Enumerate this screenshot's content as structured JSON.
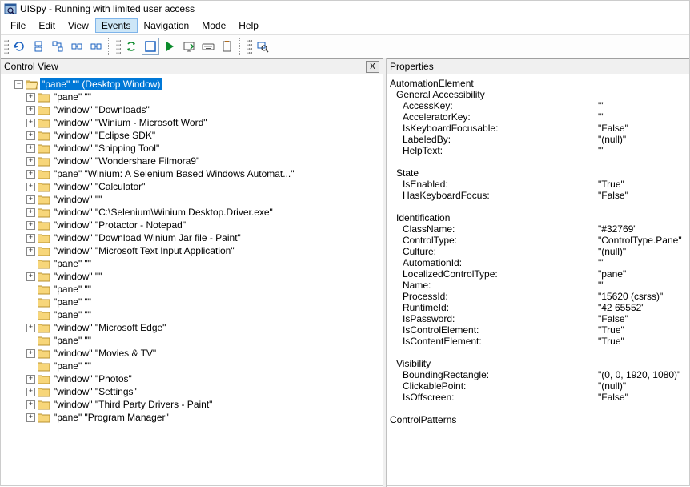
{
  "title": "UISpy - Running with limited user access",
  "menus": {
    "file": "File",
    "edit": "Edit",
    "view": "View",
    "events": "Events",
    "navigation": "Navigation",
    "mode": "Mode",
    "help": "Help"
  },
  "panels": {
    "controlView": "Control View",
    "properties": "Properties",
    "closeX": "X"
  },
  "tree": {
    "root": "\"pane\" \"\" (Desktop Window)",
    "items": [
      {
        "expand": "+",
        "label": "\"pane\" \"\""
      },
      {
        "expand": "+",
        "label": "\"window\" \"Downloads\""
      },
      {
        "expand": "+",
        "label": "\"window\" \"Winium - Microsoft Word\""
      },
      {
        "expand": "+",
        "label": "\"window\" \"Eclipse SDK\""
      },
      {
        "expand": "+",
        "label": "\"window\" \"Snipping Tool\""
      },
      {
        "expand": "+",
        "label": "\"window\" \"Wondershare Filmora9\""
      },
      {
        "expand": "+",
        "label": "\"pane\" \"Winium: A Selenium Based Windows Automat...\""
      },
      {
        "expand": "+",
        "label": "\"window\" \"Calculator\""
      },
      {
        "expand": "+",
        "label": "\"window\" \"\""
      },
      {
        "expand": "+",
        "label": "\"window\" \"C:\\Selenium\\Winium.Desktop.Driver.exe\""
      },
      {
        "expand": "+",
        "label": "\"window\" \"Protactor - Notepad\""
      },
      {
        "expand": "+",
        "label": "\"window\" \"Download Winium Jar file - Paint\""
      },
      {
        "expand": "+",
        "label": "\"window\" \"Microsoft Text Input Application\""
      },
      {
        "expand": "",
        "label": "\"pane\" \"\""
      },
      {
        "expand": "+",
        "label": "\"window\" \"\""
      },
      {
        "expand": "",
        "label": "\"pane\" \"\""
      },
      {
        "expand": "",
        "label": "\"pane\" \"\""
      },
      {
        "expand": "",
        "label": "\"pane\" \"\""
      },
      {
        "expand": "+",
        "label": "\"window\" \"Microsoft Edge\""
      },
      {
        "expand": "",
        "label": "\"pane\" \"\""
      },
      {
        "expand": "+",
        "label": "\"window\" \"Movies & TV\""
      },
      {
        "expand": "",
        "label": "\"pane\" \"\""
      },
      {
        "expand": "+",
        "label": "\"window\" \"Photos\""
      },
      {
        "expand": "+",
        "label": "\"window\" \"Settings\""
      },
      {
        "expand": "+",
        "label": "\"window\" \"Third Party Drivers - Paint\""
      },
      {
        "expand": "+",
        "label": "\"pane\" \"Program Manager\""
      }
    ]
  },
  "props": {
    "header1": "AutomationElement",
    "group_general": "General Accessibility",
    "AccessKey": {
      "k": "AccessKey:",
      "v": "\"\""
    },
    "AcceleratorKey": {
      "k": "AcceleratorKey:",
      "v": "\"\""
    },
    "IsKeyboardFocusable": {
      "k": "IsKeyboardFocusable:",
      "v": "\"False\""
    },
    "LabeledBy": {
      "k": "LabeledBy:",
      "v": "\"(null)\""
    },
    "HelpText": {
      "k": "HelpText:",
      "v": "\"\""
    },
    "group_state": "State",
    "IsEnabled": {
      "k": "IsEnabled:",
      "v": "\"True\""
    },
    "HasKeyboardFocus": {
      "k": "HasKeyboardFocus:",
      "v": "\"False\""
    },
    "group_ident": "Identification",
    "ClassName": {
      "k": "ClassName:",
      "v": "\"#32769\""
    },
    "ControlType": {
      "k": "ControlType:",
      "v": "\"ControlType.Pane\""
    },
    "Culture": {
      "k": "Culture:",
      "v": "\"(null)\""
    },
    "AutomationId": {
      "k": "AutomationId:",
      "v": "\"\""
    },
    "LocalizedControlType": {
      "k": "LocalizedControlType:",
      "v": "\"pane\""
    },
    "Name": {
      "k": "Name:",
      "v": "\"\""
    },
    "ProcessId": {
      "k": "ProcessId:",
      "v": "\"15620 (csrss)\""
    },
    "RuntimeId": {
      "k": "RuntimeId:",
      "v": "\"42 65552\""
    },
    "IsPassword": {
      "k": "IsPassword:",
      "v": "\"False\""
    },
    "IsControlElement": {
      "k": "IsControlElement:",
      "v": "\"True\""
    },
    "IsContentElement": {
      "k": "IsContentElement:",
      "v": "\"True\""
    },
    "group_vis": "Visibility",
    "BoundingRectangle": {
      "k": "BoundingRectangle:",
      "v": "\"(0, 0, 1920, 1080)\""
    },
    "ClickablePoint": {
      "k": "ClickablePoint:",
      "v": "\"(null)\""
    },
    "IsOffscreen": {
      "k": "IsOffscreen:",
      "v": "\"False\""
    },
    "header2": "ControlPatterns"
  }
}
